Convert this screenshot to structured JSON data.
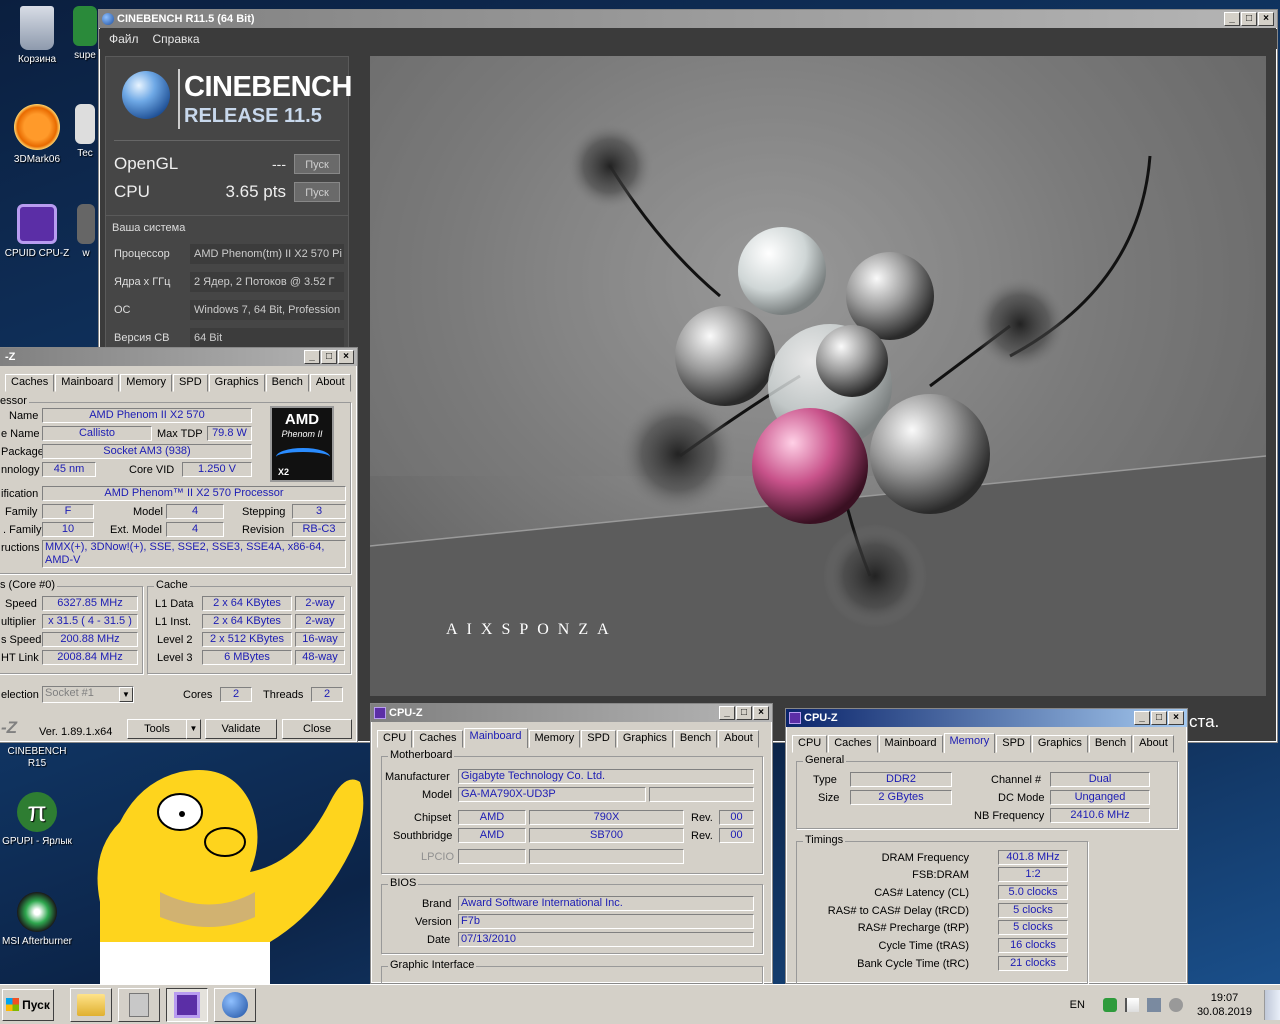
{
  "desktop": {
    "icons": [
      {
        "label": "Корзина"
      },
      {
        "label": "supe"
      },
      {
        "label": "3DMark06"
      },
      {
        "label": "Tec"
      },
      {
        "label": "CPUID CPU-Z"
      },
      {
        "label": "w"
      },
      {
        "label": "CINEBENCH R15"
      },
      {
        "label": "GPUPI - Ярлык"
      },
      {
        "label": "MSI Afterburner"
      }
    ]
  },
  "cinebench": {
    "title": "CINEBENCH R11.5 (64 Bit)",
    "menu": [
      "Файл",
      "Справка"
    ],
    "logo_main": "CINEBENCH",
    "logo_sub": "RELEASE 11.5",
    "opengl_label": "OpenGL",
    "opengl_value": "---",
    "cpu_label": "CPU",
    "cpu_value": "3.65 pts",
    "run_label": "Пуск",
    "system_title": "Ваша система",
    "system": [
      {
        "k": "Процессор",
        "v": "AMD Phenom(tm) II X2 570 Pi"
      },
      {
        "k": "Ядра x ГГц",
        "v": "2 Ядер, 2 Потоков @ 3.52 Г"
      },
      {
        "k": "ОС",
        "v": "Windows 7, 64 Bit, Profession"
      },
      {
        "k": "Версия CB",
        "v": "64 Bit"
      }
    ],
    "watermark": "AIXSPONZA",
    "tail_text": "ста."
  },
  "cpuz1": {
    "title": "-Z",
    "tabs": [
      "Caches",
      "Mainboard",
      "Memory",
      "SPD",
      "Graphics",
      "Bench",
      "About"
    ],
    "processor_group": "essor",
    "name_label": "Name",
    "name": "AMD Phenom II X2 570",
    "codename_label": "e Name",
    "codename": "Callisto",
    "maxtdp_label": "Max TDP",
    "maxtdp": "79.8 W",
    "package_label": "Package",
    "package": "Socket AM3 (938)",
    "tech_label": "nnology",
    "tech": "45 nm",
    "corevid_label": "Core VID",
    "corevid": "1.250 V",
    "spec_label": "ification",
    "spec": "AMD Phenom™ II X2 570 Processor",
    "family_label": "Family",
    "family": "F",
    "model_label": "Model",
    "model": "4",
    "stepping_label": "Stepping",
    "stepping": "3",
    "extfamily_label": ". Family",
    "extfamily": "10",
    "extmodel_label": "Ext. Model",
    "extmodel": "4",
    "revision_label": "Revision",
    "revision": "RB-C3",
    "instr_label": "ructions",
    "instr": "MMX(+), 3DNow!(+), SSE, SSE2, SSE3, SSE4A, x86-64, AMD-V",
    "logo_brand": "AMD",
    "logo_line": "Phenom II",
    "logo_x2": "X2",
    "clocks_group": "s (Core #0)",
    "corespeed_label": "Speed",
    "corespeed": "6327.85 MHz",
    "mult_label": "ultiplier",
    "mult": "x 31.5 ( 4 - 31.5 )",
    "bus_label": "s Speed",
    "bus": "200.88 MHz",
    "ht_label": "HT Link",
    "ht": "2008.84 MHz",
    "cache_group": "Cache",
    "l1d_label": "L1 Data",
    "l1d": "2 x 64 KBytes",
    "l1d_way": "2-way",
    "l1i_label": "L1 Inst.",
    "l1i": "2 x 64 KBytes",
    "l1i_way": "2-way",
    "l2_label": "Level 2",
    "l2": "2 x 512 KBytes",
    "l2_way": "16-way",
    "l3_label": "Level 3",
    "l3": "6 MBytes",
    "l3_way": "48-way",
    "selection_label": "election",
    "selection": "Socket #1",
    "cores_label": "Cores",
    "cores": "2",
    "threads_label": "Threads",
    "threads": "2",
    "brand": "-Z",
    "version": "Ver. 1.89.1.x64",
    "tools": "Tools",
    "validate": "Validate",
    "close": "Close"
  },
  "cpuz2": {
    "title": "CPU-Z",
    "tabs": [
      "CPU",
      "Caches",
      "Mainboard",
      "Memory",
      "SPD",
      "Graphics",
      "Bench",
      "About"
    ],
    "active_tab": "Mainboard",
    "mb_group": "Motherboard",
    "manufacturer_label": "Manufacturer",
    "manufacturer": "Gigabyte Technology Co. Ltd.",
    "model_label": "Model",
    "model": "GA-MA790X-UD3P",
    "chipset_label": "Chipset",
    "chipset_vendor": "AMD",
    "chipset": "790X",
    "chipset_rev_label": "Rev.",
    "chipset_rev": "00",
    "south_label": "Southbridge",
    "south_vendor": "AMD",
    "south": "SB700",
    "south_rev_label": "Rev.",
    "south_rev": "00",
    "lpcio_label": "LPCIO",
    "bios_group": "BIOS",
    "brand_label": "Brand",
    "brand": "Award Software International Inc.",
    "version_label": "Version",
    "version": "F7b",
    "date_label": "Date",
    "date": "07/13/2010",
    "gi_group": "Graphic Interface"
  },
  "cpuz3": {
    "title": "CPU-Z",
    "tabs": [
      "CPU",
      "Caches",
      "Mainboard",
      "Memory",
      "SPD",
      "Graphics",
      "Bench",
      "About"
    ],
    "active_tab": "Memory",
    "general_group": "General",
    "type_label": "Type",
    "type": "DDR2",
    "size_label": "Size",
    "size": "2 GBytes",
    "channel_label": "Channel #",
    "channel": "Dual",
    "dcmode_label": "DC Mode",
    "dcmode": "Unganged",
    "nbfreq_label": "NB Frequency",
    "nbfreq": "2410.6 MHz",
    "timings_group": "Timings",
    "timings": [
      {
        "k": "DRAM Frequency",
        "v": "401.8 MHz"
      },
      {
        "k": "FSB:DRAM",
        "v": "1:2"
      },
      {
        "k": "CAS# Latency (CL)",
        "v": "5.0 clocks"
      },
      {
        "k": "RAS# to CAS# Delay (tRCD)",
        "v": "5 clocks"
      },
      {
        "k": "RAS# Precharge (tRP)",
        "v": "5 clocks"
      },
      {
        "k": "Cycle Time (tRAS)",
        "v": "16 clocks"
      },
      {
        "k": "Bank Cycle Time (tRC)",
        "v": "21 clocks"
      }
    ]
  },
  "taskbar": {
    "start": "Пуск",
    "lang": "EN",
    "time": "19:07",
    "date": "30.08.2019"
  }
}
